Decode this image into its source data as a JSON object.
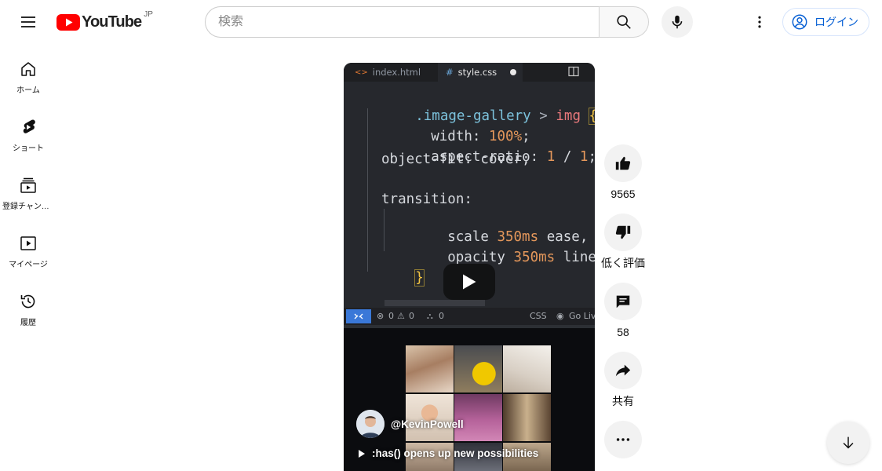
{
  "header": {
    "logo_text": "YouTube",
    "region_code": "JP",
    "search_placeholder": "検索",
    "search_value": "",
    "login_label": "ログイン"
  },
  "guide": {
    "items": [
      {
        "label": "ホーム",
        "icon": "home-icon"
      },
      {
        "label": "ショート",
        "icon": "shorts-icon"
      },
      {
        "label": "登録チャンネル",
        "icon": "subscriptions-icon"
      },
      {
        "label": "マイページ",
        "icon": "you-icon"
      },
      {
        "label": "履歴",
        "icon": "history-icon"
      }
    ]
  },
  "video": {
    "editor_tabs": [
      "index.html",
      "style.css"
    ],
    "code_lines": {
      "l1_selector": ".image-gallery",
      "l1_combinator": ">",
      "l1_tag": "img",
      "l1_brace": "{",
      "l2_prop": "width:",
      "l2_val": "100%",
      "l2_end": ";",
      "l3_prop": "aspect-ratio:",
      "l3_val1": "1",
      "l3_slash": "/",
      "l3_val2": "1",
      "l3_end": ";",
      "l4": "object-fit: cover;",
      "l5": "transition:",
      "l6_prop": "scale",
      "l6_val": "350ms",
      "l6_end": "ease,",
      "l7_prop": "opacity",
      "l7_val": "350ms",
      "l7_end": "linear;",
      "l8_brace": "}"
    },
    "status_bar": {
      "errors": "0",
      "warnings": "0",
      "ports": "0",
      "language": "CSS",
      "golive": "Go Liv"
    },
    "owner_handle": "@KevinPowell",
    "title": ":has() opens up new possibilities"
  },
  "actions": {
    "like_count": "9565",
    "dislike_label": "低く評価",
    "comment_count": "58",
    "share_label": "共有"
  },
  "colors": {
    "brand_red": "#ff0000",
    "link_blue": "#065fd4",
    "button_gray": "#f2f2f2"
  }
}
